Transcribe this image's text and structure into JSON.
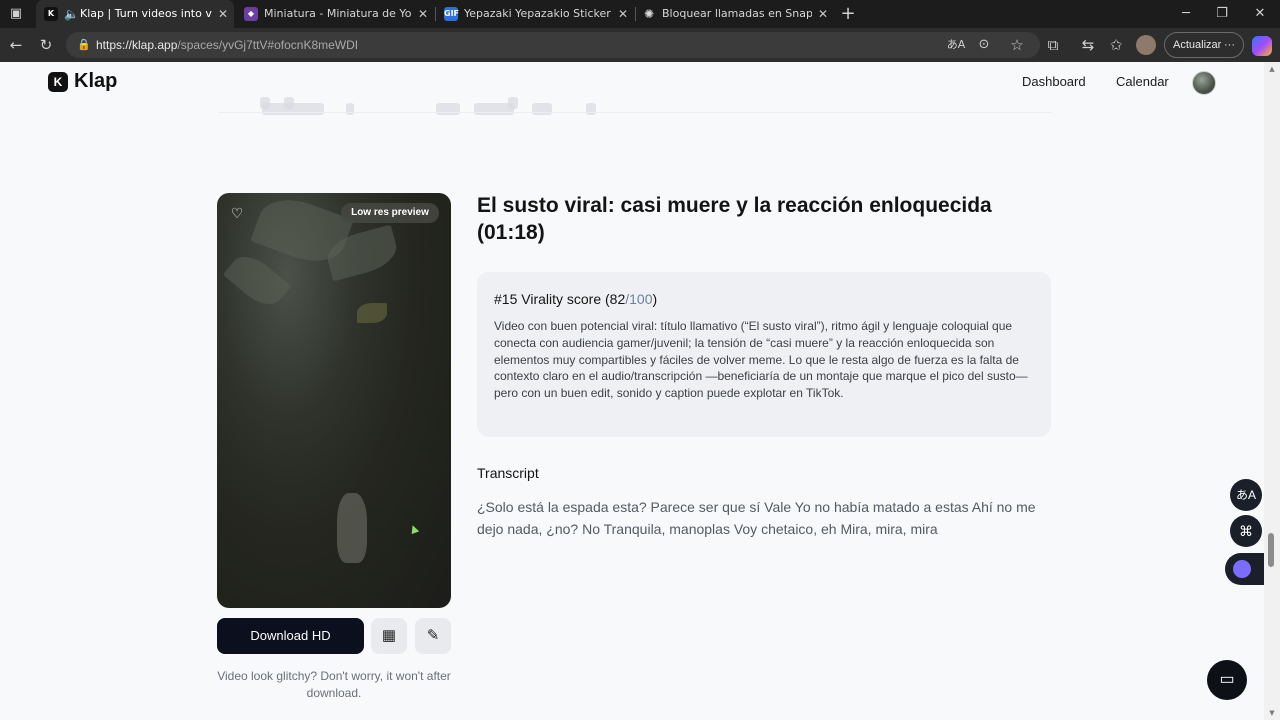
{
  "browser": {
    "tabs": [
      {
        "title": "Klap | Turn videos into viral s",
        "favicon": "klap-icon",
        "active": true
      },
      {
        "title": "Miniatura - Miniatura de YouTube",
        "favicon": "shield-icon",
        "active": false
      },
      {
        "title": "Yepazaki Yepazakio Sticker - YEPA",
        "favicon": "gif-icon",
        "active": false
      },
      {
        "title": "Bloquear llamadas en Snapchat",
        "favicon": "chatgpt-icon",
        "active": false
      }
    ],
    "url_main": "https://klap.app",
    "url_path": "/spaces/yvGj7ttV#ofocnK8meWDI",
    "update_label": "Actualizar",
    "update_more": "···"
  },
  "header": {
    "logo_text": "Klap",
    "nav": [
      "Dashboard",
      "Calendar"
    ]
  },
  "clip": {
    "preview_badge": "Low res preview",
    "title": "El susto viral: casi muere y la reacción enloquecida (01:18)",
    "score_prefix": "#15 Virality score (82",
    "score_max": "/100",
    "score_suffix": ")",
    "score_description": "Video con buen potencial viral: título llamativo (“El susto viral”), ritmo ágil y lenguaje coloquial que conecta con audiencia gamer/juvenil; la tensión de “casi muere” y la reacción enloquecida son elementos muy compartibles y fáciles de volver meme. Lo que le resta algo de fuerza es la falta de contexto claro en el audio/transcripción —beneficiaría de un montaje que marque el pico del susto— pero con un buen edit, sonido y caption puede explotar en TikTok.",
    "transcript_label": "Transcript",
    "transcript_text": "¿Solo está la espada esta? Parece ser que sí Vale Yo no había matado a estas Ahí no me dejo nada, ¿no? No Tranquila, manoplas Voy chetaico, eh Mira, mira, mira",
    "download_label": "Download HD",
    "glitch_note": "Video look glitchy? Don't worry, it won't after download."
  },
  "colors": {
    "page_bg": "#f8f9fb",
    "primary_button": "#0b0f1e",
    "score_accent": "#6f7fa0"
  }
}
